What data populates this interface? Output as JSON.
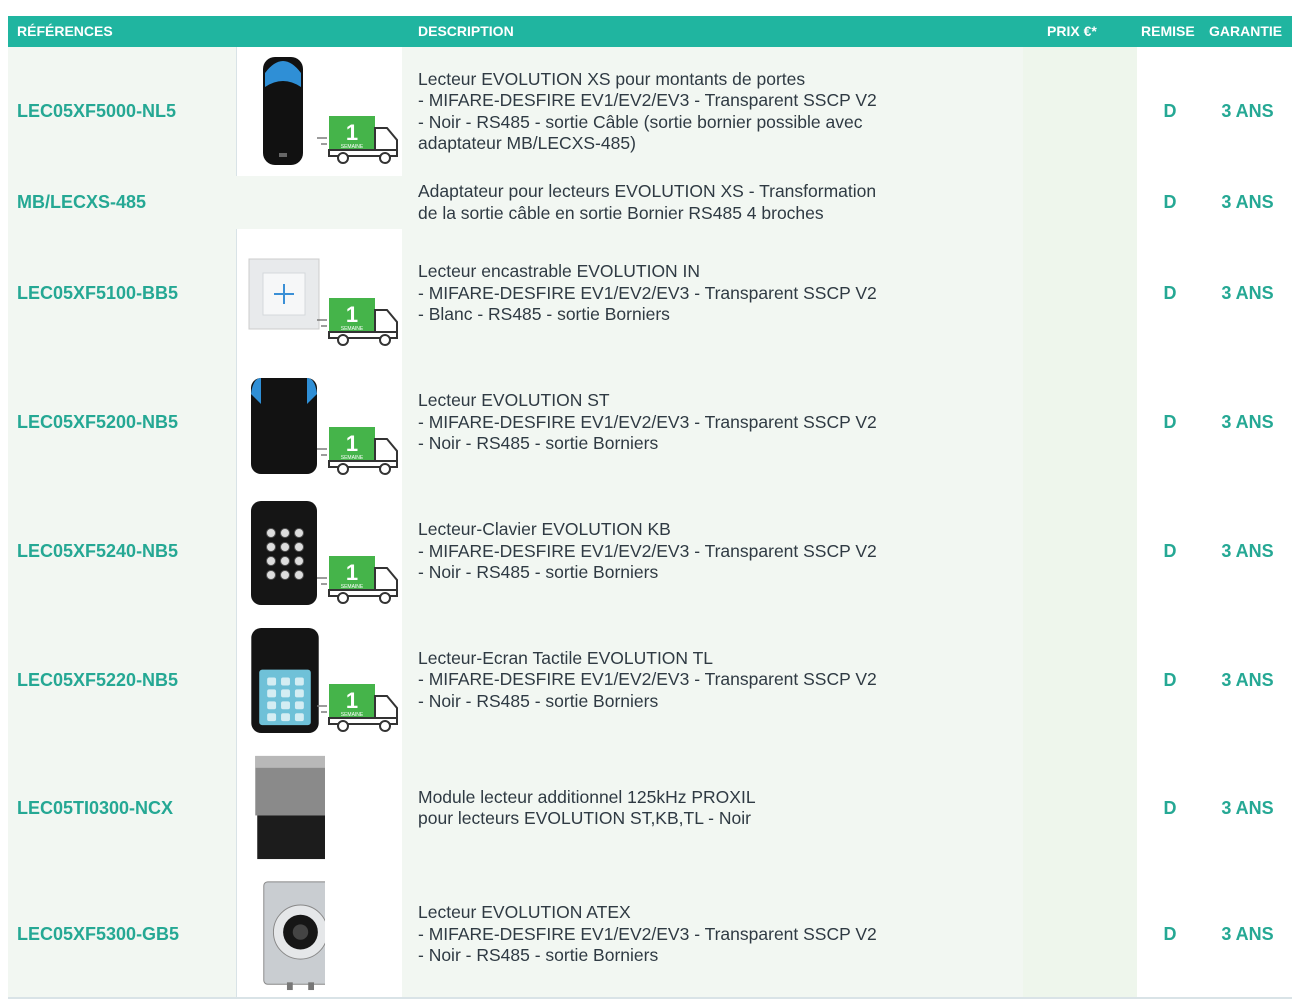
{
  "headers": {
    "references": "RÉFÉRENCES",
    "description": "DESCRIPTION",
    "prix": "PRIX €*",
    "remise": "REMISE",
    "garantie": "GARANTIE"
  },
  "colors": {
    "header_bg": "#20b5a0",
    "accent_text": "#25a894",
    "row_tint": "#f2f7f2",
    "separator": "#d9e3e7"
  },
  "truck_badge": {
    "number": "1",
    "label": "SEMAINE"
  },
  "rows": [
    {
      "ref": "LEC05XF5000-NL5",
      "image": "black-reader-xs",
      "has_truck": true,
      "desc": [
        "Lecteur EVOLUTION XS pour montants de portes",
        "- MIFARE-DESFIRE EV1/EV2/EV3 - Transparent SSCP V2",
        "- Noir - RS485 - sortie Câble (sortie bornier possible avec",
        "adaptateur MB/LECXS-485)"
      ],
      "remise": "D",
      "garantie": "3 ANS"
    },
    {
      "ref": "MB/LECXS-485",
      "image": "",
      "has_truck": false,
      "desc": [
        "Adaptateur pour lecteurs EVOLUTION XS - Transformation",
        "de la sortie câble en sortie Bornier RS485 4 broches"
      ],
      "remise": "D",
      "garantie": "3 ANS"
    },
    {
      "ref": "LEC05XF5100-BB5",
      "image": "white-flush-reader",
      "has_truck": true,
      "desc": [
        "Lecteur encastrable EVOLUTION IN",
        "- MIFARE-DESFIRE EV1/EV2/EV3 - Transparent SSCP V2",
        "- Blanc - RS485 - sortie Borniers"
      ],
      "remise": "D",
      "garantie": "3 ANS"
    },
    {
      "ref": "LEC05XF5200-NB5",
      "image": "black-reader-st",
      "has_truck": true,
      "desc": [
        "Lecteur EVOLUTION ST",
        "- MIFARE-DESFIRE EV1/EV2/EV3 - Transparent SSCP V2",
        "- Noir - RS485 - sortie Borniers"
      ],
      "remise": "D",
      "garantie": "3 ANS"
    },
    {
      "ref": "LEC05XF5240-NB5",
      "image": "keypad-reader-kb",
      "has_truck": true,
      "desc": [
        "Lecteur-Clavier EVOLUTION KB",
        "- MIFARE-DESFIRE EV1/EV2/EV3 - Transparent SSCP V2",
        "- Noir - RS485 - sortie Borniers"
      ],
      "remise": "D",
      "garantie": "3 ANS"
    },
    {
      "ref": "LEC05XF5220-NB5",
      "image": "touchscreen-reader-tl",
      "has_truck": true,
      "desc": [
        "Lecteur-Ecran Tactile EVOLUTION TL",
        "- MIFARE-DESFIRE EV1/EV2/EV3 - Transparent SSCP V2",
        "- Noir - RS485 - sortie Borniers"
      ],
      "remise": "D",
      "garantie": "3 ANS"
    },
    {
      "ref": "LEC05TI0300-NCX",
      "image": "proxil-module",
      "has_truck": false,
      "desc": [
        "Module lecteur additionnel 125kHz PROXIL",
        "pour lecteurs EVOLUTION ST,KB,TL - Noir"
      ],
      "remise": "D",
      "garantie": "3 ANS"
    },
    {
      "ref": "LEC05XF5300-GB5",
      "image": "atex-reader",
      "has_truck": false,
      "desc": [
        "Lecteur EVOLUTION ATEX",
        "- MIFARE-DESFIRE EV1/EV2/EV3 - Transparent SSCP V2",
        "- Noir - RS485 - sortie Borniers"
      ],
      "remise": "D",
      "garantie": "3 ANS"
    }
  ]
}
